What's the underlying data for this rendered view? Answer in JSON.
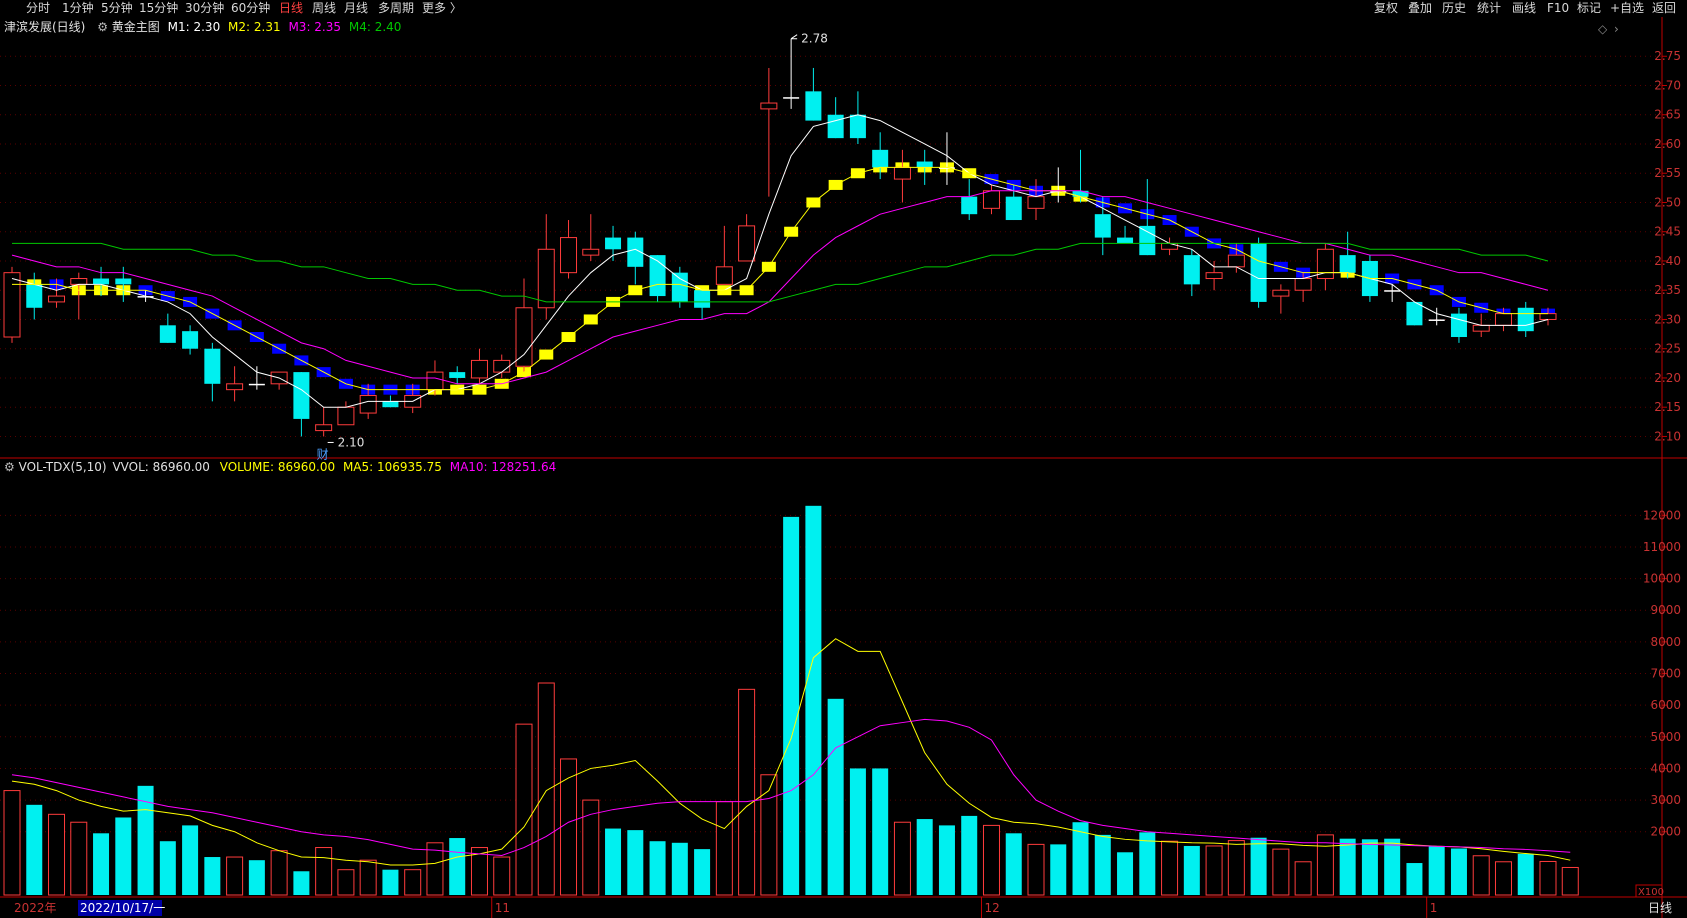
{
  "toolbar": {
    "periods": [
      {
        "label": "分时",
        "active": false
      },
      {
        "label": "1分钟",
        "active": false
      },
      {
        "label": "5分钟",
        "active": false
      },
      {
        "label": "15分钟",
        "active": false
      },
      {
        "label": "30分钟",
        "active": false
      },
      {
        "label": "60分钟",
        "active": false
      },
      {
        "label": "日线",
        "active": true
      },
      {
        "label": "周线",
        "active": false
      },
      {
        "label": "月线",
        "active": false
      },
      {
        "label": "多周期",
        "active": false
      },
      {
        "label": "更多 〉",
        "active": false
      }
    ],
    "tools": [
      "复权",
      "叠加",
      "历史",
      "统计",
      "画线",
      "F10",
      "标记",
      "+自选",
      "返回"
    ]
  },
  "main_legend": {
    "stock": "津滨发展(日线)",
    "indicator": "黄金主图",
    "m1": "M1: 2.30",
    "m2": "M2: 2.31",
    "m3": "M3: 2.35",
    "m4": "M4: 2.40"
  },
  "volume_legend": {
    "indicator": "VOL-TDX(5,10)",
    "vvol": "VVOL: 86960.00",
    "volume": "VOLUME: 86960.00",
    "ma5": "MA5: 106935.75",
    "ma10": "MA10: 128251.64"
  },
  "bottom_axis": {
    "year": "2022年",
    "cursor_date": "2022/10/17/一",
    "month_labels": [
      "11",
      "12",
      "1"
    ],
    "unit": "X100",
    "period": "日线"
  },
  "annotations": {
    "high": "2.78",
    "low": "2.10",
    "marker": "财"
  },
  "colors": {
    "up": "#ff3c3c",
    "down": "#00f0f0",
    "m1": "#ffffff",
    "m2": "#ffff00",
    "m3": "#ff00ff",
    "m4": "#00c800",
    "golden_down": "#0000ff",
    "golden_up": "#ffff00",
    "axis": "#c00000",
    "grid": "#5a0000"
  },
  "chart_data": [
    {
      "type": "candlestick",
      "title": "津滨发展(日线)",
      "y_ticks": [
        2.1,
        2.15,
        2.2,
        2.25,
        2.3,
        2.35,
        2.4,
        2.45,
        2.5,
        2.55,
        2.6,
        2.65,
        2.7,
        2.75
      ],
      "ylim": [
        2.07,
        2.8
      ],
      "candles": [
        {
          "o": 2.27,
          "h": 2.39,
          "l": 2.26,
          "c": 2.38
        },
        {
          "o": 2.36,
          "h": 2.38,
          "l": 2.3,
          "c": 2.32
        },
        {
          "o": 2.33,
          "h": 2.37,
          "l": 2.32,
          "c": 2.34
        },
        {
          "o": 2.36,
          "h": 2.38,
          "l": 2.3,
          "c": 2.37
        },
        {
          "o": 2.37,
          "h": 2.39,
          "l": 2.34,
          "c": 2.36
        },
        {
          "o": 2.37,
          "h": 2.39,
          "l": 2.33,
          "c": 2.36
        },
        {
          "o": 2.34,
          "h": 2.35,
          "l": 2.33,
          "c": 2.34
        },
        {
          "o": 2.29,
          "h": 2.31,
          "l": 2.26,
          "c": 2.26
        },
        {
          "o": 2.28,
          "h": 2.29,
          "l": 2.24,
          "c": 2.25
        },
        {
          "o": 2.25,
          "h": 2.26,
          "l": 2.16,
          "c": 2.19
        },
        {
          "o": 2.18,
          "h": 2.22,
          "l": 2.16,
          "c": 2.19
        },
        {
          "o": 2.19,
          "h": 2.22,
          "l": 2.18,
          "c": 2.19
        },
        {
          "o": 2.19,
          "h": 2.21,
          "l": 2.18,
          "c": 2.21
        },
        {
          "o": 2.21,
          "h": 2.21,
          "l": 2.1,
          "c": 2.13
        },
        {
          "o": 2.11,
          "h": 2.15,
          "l": 2.1,
          "c": 2.12
        },
        {
          "o": 2.12,
          "h": 2.16,
          "l": 2.12,
          "c": 2.15
        },
        {
          "o": 2.14,
          "h": 2.19,
          "l": 2.13,
          "c": 2.17
        },
        {
          "o": 2.16,
          "h": 2.17,
          "l": 2.15,
          "c": 2.15
        },
        {
          "o": 2.15,
          "h": 2.19,
          "l": 2.14,
          "c": 2.17
        },
        {
          "o": 2.18,
          "h": 2.23,
          "l": 2.17,
          "c": 2.21
        },
        {
          "o": 2.21,
          "h": 2.22,
          "l": 2.19,
          "c": 2.2
        },
        {
          "o": 2.2,
          "h": 2.25,
          "l": 2.19,
          "c": 2.23
        },
        {
          "o": 2.21,
          "h": 2.24,
          "l": 2.2,
          "c": 2.23
        },
        {
          "o": 2.22,
          "h": 2.37,
          "l": 2.21,
          "c": 2.32
        },
        {
          "o": 2.32,
          "h": 2.48,
          "l": 2.3,
          "c": 2.42
        },
        {
          "o": 2.38,
          "h": 2.47,
          "l": 2.37,
          "c": 2.44
        },
        {
          "o": 2.41,
          "h": 2.48,
          "l": 2.4,
          "c": 2.42
        },
        {
          "o": 2.44,
          "h": 2.46,
          "l": 2.4,
          "c": 2.42
        },
        {
          "o": 2.44,
          "h": 2.45,
          "l": 2.36,
          "c": 2.39
        },
        {
          "o": 2.41,
          "h": 2.41,
          "l": 2.33,
          "c": 2.34
        },
        {
          "o": 2.38,
          "h": 2.39,
          "l": 2.32,
          "c": 2.33
        },
        {
          "o": 2.35,
          "h": 2.35,
          "l": 2.3,
          "c": 2.32
        },
        {
          "o": 2.36,
          "h": 2.46,
          "l": 2.36,
          "c": 2.39
        },
        {
          "o": 2.4,
          "h": 2.48,
          "l": 2.4,
          "c": 2.46
        },
        {
          "o": 2.66,
          "h": 2.73,
          "l": 2.51,
          "c": 2.67
        },
        {
          "o": 2.68,
          "h": 2.78,
          "l": 2.66,
          "c": 2.68
        },
        {
          "o": 2.69,
          "h": 2.73,
          "l": 2.64,
          "c": 2.64
        },
        {
          "o": 2.65,
          "h": 2.68,
          "l": 2.61,
          "c": 2.61
        },
        {
          "o": 2.65,
          "h": 2.69,
          "l": 2.6,
          "c": 2.61
        },
        {
          "o": 2.59,
          "h": 2.62,
          "l": 2.54,
          "c": 2.56
        },
        {
          "o": 2.54,
          "h": 2.59,
          "l": 2.5,
          "c": 2.56
        },
        {
          "o": 2.57,
          "h": 2.59,
          "l": 2.53,
          "c": 2.56
        },
        {
          "o": 2.56,
          "h": 2.62,
          "l": 2.53,
          "c": 2.56
        },
        {
          "o": 2.51,
          "h": 2.54,
          "l": 2.47,
          "c": 2.48
        },
        {
          "o": 2.49,
          "h": 2.53,
          "l": 2.48,
          "c": 2.52
        },
        {
          "o": 2.51,
          "h": 2.53,
          "l": 2.47,
          "c": 2.47
        },
        {
          "o": 2.49,
          "h": 2.54,
          "l": 2.47,
          "c": 2.51
        },
        {
          "o": 2.52,
          "h": 2.56,
          "l": 2.5,
          "c": 2.52
        },
        {
          "o": 2.52,
          "h": 2.59,
          "l": 2.5,
          "c": 2.51
        },
        {
          "o": 2.48,
          "h": 2.51,
          "l": 2.41,
          "c": 2.44
        },
        {
          "o": 2.44,
          "h": 2.46,
          "l": 2.43,
          "c": 2.43
        },
        {
          "o": 2.46,
          "h": 2.54,
          "l": 2.41,
          "c": 2.41
        },
        {
          "o": 2.42,
          "h": 2.44,
          "l": 2.41,
          "c": 2.43
        },
        {
          "o": 2.41,
          "h": 2.42,
          "l": 2.34,
          "c": 2.36
        },
        {
          "o": 2.37,
          "h": 2.4,
          "l": 2.35,
          "c": 2.38
        },
        {
          "o": 2.39,
          "h": 2.43,
          "l": 2.38,
          "c": 2.41
        },
        {
          "o": 2.43,
          "h": 2.44,
          "l": 2.32,
          "c": 2.33
        },
        {
          "o": 2.34,
          "h": 2.36,
          "l": 2.31,
          "c": 2.35
        },
        {
          "o": 2.35,
          "h": 2.38,
          "l": 2.33,
          "c": 2.37
        },
        {
          "o": 2.37,
          "h": 2.43,
          "l": 2.35,
          "c": 2.42
        },
        {
          "o": 2.41,
          "h": 2.45,
          "l": 2.37,
          "c": 2.38
        },
        {
          "o": 2.4,
          "h": 2.41,
          "l": 2.33,
          "c": 2.34
        },
        {
          "o": 2.35,
          "h": 2.36,
          "l": 2.33,
          "c": 2.35
        },
        {
          "o": 2.33,
          "h": 2.33,
          "l": 2.29,
          "c": 2.29
        },
        {
          "o": 2.3,
          "h": 2.32,
          "l": 2.29,
          "c": 2.3
        },
        {
          "o": 2.31,
          "h": 2.32,
          "l": 2.26,
          "c": 2.27
        },
        {
          "o": 2.28,
          "h": 2.31,
          "l": 2.27,
          "c": 2.29
        },
        {
          "o": 2.29,
          "h": 2.32,
          "l": 2.28,
          "c": 2.31
        },
        {
          "o": 2.32,
          "h": 2.33,
          "l": 2.27,
          "c": 2.28
        },
        {
          "o": 2.3,
          "h": 2.32,
          "l": 2.29,
          "c": 2.31
        }
      ],
      "series": [
        {
          "name": "M1",
          "values": [
            2.37,
            2.36,
            2.35,
            2.36,
            2.36,
            2.35,
            2.34,
            2.33,
            2.31,
            2.27,
            2.24,
            2.21,
            2.2,
            2.18,
            2.15,
            2.15,
            2.16,
            2.16,
            2.16,
            2.18,
            2.18,
            2.19,
            2.21,
            2.24,
            2.29,
            2.34,
            2.38,
            2.41,
            2.42,
            2.4,
            2.37,
            2.35,
            2.35,
            2.37,
            2.48,
            2.58,
            2.63,
            2.64,
            2.65,
            2.64,
            2.62,
            2.6,
            2.58,
            2.55,
            2.53,
            2.52,
            2.51,
            2.52,
            2.51,
            2.49,
            2.47,
            2.45,
            2.43,
            2.42,
            2.39,
            2.39,
            2.37,
            2.37,
            2.37,
            2.38,
            2.38,
            2.37,
            2.36,
            2.33,
            2.31,
            2.3,
            2.29,
            2.29,
            2.29,
            2.3
          ]
        },
        {
          "name": "M2",
          "values": [
            2.36,
            2.36,
            2.36,
            2.35,
            2.35,
            2.35,
            2.35,
            2.34,
            2.33,
            2.31,
            2.29,
            2.27,
            2.25,
            2.23,
            2.21,
            2.19,
            2.18,
            2.18,
            2.18,
            2.18,
            2.18,
            2.18,
            2.19,
            2.21,
            2.24,
            2.27,
            2.3,
            2.33,
            2.35,
            2.36,
            2.36,
            2.35,
            2.35,
            2.35,
            2.39,
            2.45,
            2.5,
            2.53,
            2.55,
            2.56,
            2.56,
            2.56,
            2.56,
            2.55,
            2.54,
            2.53,
            2.52,
            2.52,
            2.51,
            2.5,
            2.49,
            2.48,
            2.47,
            2.45,
            2.43,
            2.42,
            2.4,
            2.39,
            2.38,
            2.38,
            2.38,
            2.37,
            2.37,
            2.36,
            2.35,
            2.33,
            2.32,
            2.31,
            2.31,
            2.31
          ]
        },
        {
          "name": "M3",
          "values": [
            2.41,
            2.4,
            2.39,
            2.39,
            2.38,
            2.38,
            2.37,
            2.36,
            2.35,
            2.34,
            2.32,
            2.3,
            2.28,
            2.26,
            2.25,
            2.23,
            2.22,
            2.21,
            2.2,
            2.2,
            2.19,
            2.19,
            2.19,
            2.2,
            2.21,
            2.23,
            2.25,
            2.27,
            2.28,
            2.29,
            2.3,
            2.3,
            2.31,
            2.31,
            2.33,
            2.37,
            2.41,
            2.44,
            2.46,
            2.48,
            2.49,
            2.5,
            2.51,
            2.51,
            2.52,
            2.52,
            2.52,
            2.52,
            2.52,
            2.51,
            2.51,
            2.5,
            2.49,
            2.48,
            2.47,
            2.46,
            2.45,
            2.44,
            2.43,
            2.43,
            2.42,
            2.41,
            2.41,
            2.4,
            2.39,
            2.38,
            2.38,
            2.37,
            2.36,
            2.35
          ]
        },
        {
          "name": "M4",
          "values": [
            2.43,
            2.43,
            2.43,
            2.43,
            2.43,
            2.42,
            2.42,
            2.42,
            2.42,
            2.41,
            2.41,
            2.4,
            2.4,
            2.39,
            2.39,
            2.38,
            2.37,
            2.37,
            2.36,
            2.36,
            2.35,
            2.35,
            2.34,
            2.34,
            2.33,
            2.33,
            2.33,
            2.33,
            2.33,
            2.33,
            2.33,
            2.33,
            2.33,
            2.33,
            2.33,
            2.34,
            2.35,
            2.36,
            2.36,
            2.37,
            2.38,
            2.39,
            2.39,
            2.4,
            2.41,
            2.41,
            2.42,
            2.42,
            2.43,
            2.43,
            2.43,
            2.43,
            2.43,
            2.43,
            2.43,
            2.43,
            2.43,
            2.43,
            2.43,
            2.43,
            2.43,
            2.42,
            2.42,
            2.42,
            2.42,
            2.42,
            2.41,
            2.41,
            2.41,
            2.4
          ]
        }
      ]
    },
    {
      "type": "bar",
      "title": "VOL-TDX(5,10)",
      "unit": "X100",
      "y_ticks": [
        2000,
        3000,
        4000,
        5000,
        6000,
        7000,
        8000,
        9000,
        10000,
        11000,
        12000
      ],
      "ylim": [
        0,
        12800
      ],
      "values": [
        3300,
        2850,
        2550,
        2300,
        1950,
        2450,
        3450,
        1700,
        2200,
        1200,
        1200,
        1100,
        1400,
        750,
        1500,
        800,
        1100,
        800,
        800,
        1650,
        1800,
        1500,
        1200,
        5400,
        6700,
        4300,
        3000,
        2100,
        2050,
        1700,
        1650,
        1450,
        2950,
        6500,
        3800,
        11950,
        12300,
        6200,
        4000,
        4000,
        2300,
        2400,
        2200,
        2500,
        2200,
        1950,
        1600,
        1600,
        2300,
        1900,
        1350,
        1980,
        1700,
        1550,
        1550,
        1720,
        1810,
        1450,
        1050,
        1900,
        1780,
        1760,
        1780,
        1010,
        1550,
        1470,
        1240,
        1050,
        1300,
        1060,
        870
      ],
      "series": [
        {
          "name": "MA5",
          "values": [
            3600,
            3500,
            3300,
            3000,
            2800,
            2650,
            2700,
            2600,
            2500,
            2200,
            2000,
            1650,
            1400,
            1200,
            1180,
            1100,
            1050,
            950,
            950,
            1000,
            1200,
            1300,
            1450,
            2150,
            3300,
            3700,
            4000,
            4100,
            4250,
            3600,
            2900,
            2400,
            2100,
            2800,
            3300,
            4950,
            7500,
            8100,
            7700,
            7700,
            6100,
            4500,
            3500,
            2900,
            2450,
            2300,
            2250,
            2150,
            2000,
            1850,
            1760,
            1710,
            1680,
            1650,
            1640,
            1600,
            1620,
            1620,
            1570,
            1540,
            1580,
            1640,
            1640,
            1580,
            1540,
            1520,
            1460,
            1380,
            1310,
            1250,
            1100
          ]
        },
        {
          "name": "MA10",
          "values": [
            3800,
            3700,
            3550,
            3400,
            3250,
            3100,
            2950,
            2800,
            2700,
            2600,
            2450,
            2300,
            2150,
            2000,
            1900,
            1850,
            1750,
            1600,
            1450,
            1420,
            1350,
            1300,
            1250,
            1500,
            1850,
            2300,
            2550,
            2700,
            2800,
            2900,
            2950,
            2950,
            2950,
            2950,
            3050,
            3300,
            3800,
            4650,
            5000,
            5350,
            5450,
            5550,
            5500,
            5300,
            4900,
            3800,
            3000,
            2650,
            2350,
            2200,
            2100,
            2000,
            1950,
            1900,
            1850,
            1800,
            1750,
            1700,
            1650,
            1650,
            1620,
            1600,
            1580,
            1560,
            1540,
            1520,
            1500,
            1460,
            1440,
            1400,
            1350
          ]
        }
      ]
    }
  ]
}
